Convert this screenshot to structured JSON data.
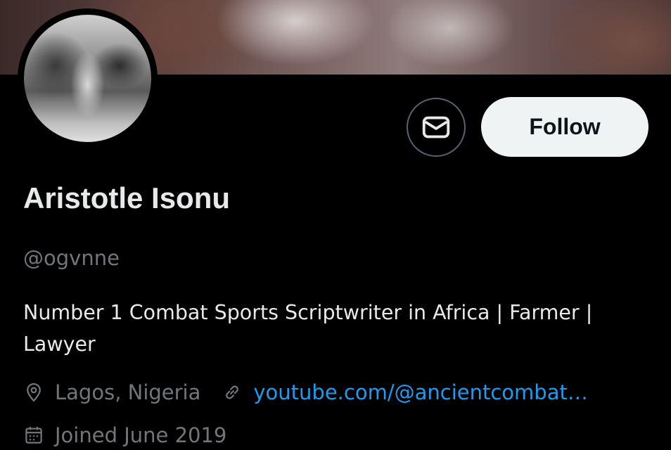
{
  "profile": {
    "display_name": "Aristotle Isonu",
    "handle": "@ogvnne",
    "bio": "Number 1 Combat Sports Scriptwriter in Africa | Farmer | Lawyer",
    "location": "Lagos, Nigeria",
    "website": "youtube.com/@ancientcombat…",
    "joined": "Joined June 2019"
  },
  "actions": {
    "follow_label": "Follow",
    "message_icon": "envelope-icon"
  },
  "icons": {
    "location": "map-pin-icon",
    "website": "link-icon",
    "joined": "calendar-icon"
  },
  "colors": {
    "background": "#000000",
    "primary_text": "#e7e9ea",
    "secondary_text": "#71767b",
    "link": "#1d9bf0",
    "follow_button_bg": "#eff3f4",
    "follow_button_text": "#0f1419",
    "border": "#536471"
  }
}
